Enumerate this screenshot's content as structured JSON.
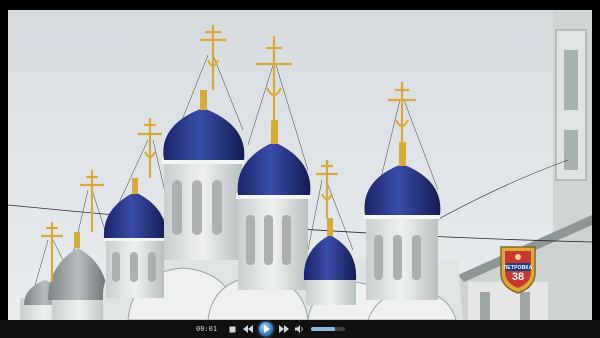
{
  "player": {
    "time_elapsed": "00:01",
    "volume_level": 0.7,
    "controls": {
      "stop": "stop-icon",
      "prev": "skip-back-icon",
      "play": "play-icon",
      "next": "skip-forward-icon",
      "volume": "speaker-icon"
    }
  },
  "channel_logo": {
    "name": "ПЕТРОВКА",
    "number": "38"
  },
  "colors": {
    "dome_blue": "#27368a",
    "gold": "#d7aa3a",
    "sky": "#dfe3e7",
    "church_white": "#e7ebe9",
    "accent": "#2a6fb8"
  }
}
